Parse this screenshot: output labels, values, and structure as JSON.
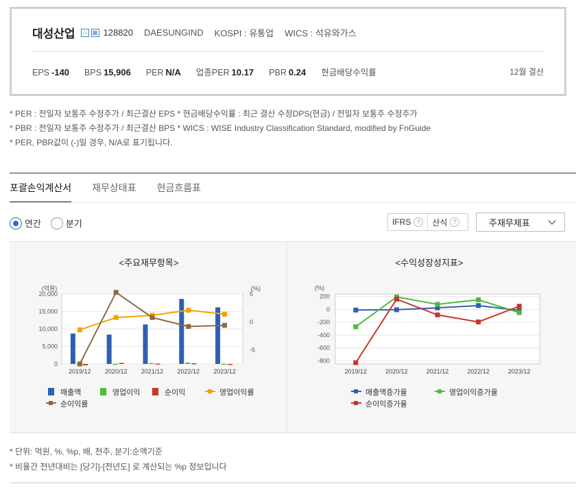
{
  "company": {
    "name": "대성산업",
    "code": "128820",
    "eng_name": "DAESUNGIND",
    "market": "KOSPI : 유통업",
    "wics": "WICS : 석유와가스"
  },
  "metrics": {
    "eps_label": "EPS",
    "eps": "-140",
    "bps_label": "BPS",
    "bps": "15,906",
    "per_label": "PER",
    "per": "N/A",
    "ind_per_label": "업종PER",
    "ind_per": "10.17",
    "pbr_label": "PBR",
    "pbr": "0.24",
    "div_label": "현금배당수익률",
    "settle": "12월 결산"
  },
  "notes": [
    "* PER : 전일자 보통주 수정주가 / 최근결산 EPS * 현금배당수익률 : 최근 결산 수정DPS(현금) / 전일자 보통주 수정주가",
    "* PBR : 전일자 보통주 수정주가 / 최근결산 BPS * WICS : WISE Industry Classification Standard, modified by FnGuide",
    "* PER, PBR값이 (-)일 경우, N/A로 표기됩니다."
  ],
  "tabs": [
    "포괄손익계산서",
    "재무상태표",
    "현금흐름표"
  ],
  "period": {
    "annual": "연간",
    "quarter": "분기"
  },
  "options": {
    "ifrs": "IFRS",
    "calc": "산식",
    "q": "?"
  },
  "select": {
    "value": "주재무제표"
  },
  "chart_titles": {
    "left": "<주요재무항목>",
    "right": "<수익성장성지표>"
  },
  "chart_data": [
    {
      "type": "bar",
      "categories": [
        "2019/12",
        "2020/12",
        "2021/12",
        "2022/12",
        "2023/12"
      ],
      "y_left": {
        "label": "(억원)",
        "ticks": [
          "20,000",
          "15,000",
          "10,000",
          "5,000",
          "0"
        ],
        "range": [
          0,
          20000
        ]
      },
      "y_right": {
        "label": "(%)",
        "ticks": [
          "5",
          "0",
          "-5"
        ],
        "range": [
          -7.5,
          5
        ]
      },
      "series": [
        {
          "name": "매출액",
          "kind": "bar",
          "axis": "left",
          "color": "#2f5fb3",
          "values": [
            8700,
            8400,
            11300,
            18600,
            16200
          ]
        },
        {
          "name": "영업이익",
          "kind": "bar",
          "axis": "left",
          "color": "#4dbb3a",
          "values": [
            100,
            50,
            250,
            400,
            80
          ]
        },
        {
          "name": "순이익",
          "kind": "bar",
          "axis": "left",
          "color": "#c8362a",
          "values": [
            -400,
            300,
            100,
            200,
            -100
          ]
        },
        {
          "name": "영업이익률",
          "kind": "line",
          "axis": "right",
          "color": "#f5a200",
          "values": [
            -1.4,
            0.8,
            1.2,
            2.1,
            1.4
          ]
        },
        {
          "name": "순이익률",
          "kind": "line",
          "axis": "right",
          "color": "#8c6a3e",
          "values": [
            -7.5,
            5.3,
            0.8,
            -0.8,
            -0.6
          ]
        }
      ]
    },
    {
      "type": "line",
      "categories": [
        "2019/12",
        "2020/12",
        "2021/12",
        "2022/12",
        "2023/12"
      ],
      "y": {
        "label": "(%)",
        "ticks": [
          "200",
          "0",
          "-200",
          "-400",
          "-600",
          "-800"
        ],
        "range": [
          -850,
          240
        ]
      },
      "series": [
        {
          "name": "매출액증가율",
          "color": "#2f5fb3",
          "values": [
            -10,
            -5,
            25,
            60,
            -15
          ]
        },
        {
          "name": "영업이익증가율",
          "color": "#4dbb3a",
          "values": [
            -270,
            195,
            80,
            150,
            -50
          ]
        },
        {
          "name": "순이익증가율",
          "color": "#c8362a",
          "values": [
            -830,
            160,
            -85,
            -195,
            50
          ]
        }
      ]
    }
  ],
  "footnotes": [
    "* 단위: 억원, %, %p, 배, 천주, 분기:순액기준",
    "* 비율간 전년대비는 [당기]-[전년도] 로 계산되는 %p 정보입니다"
  ]
}
